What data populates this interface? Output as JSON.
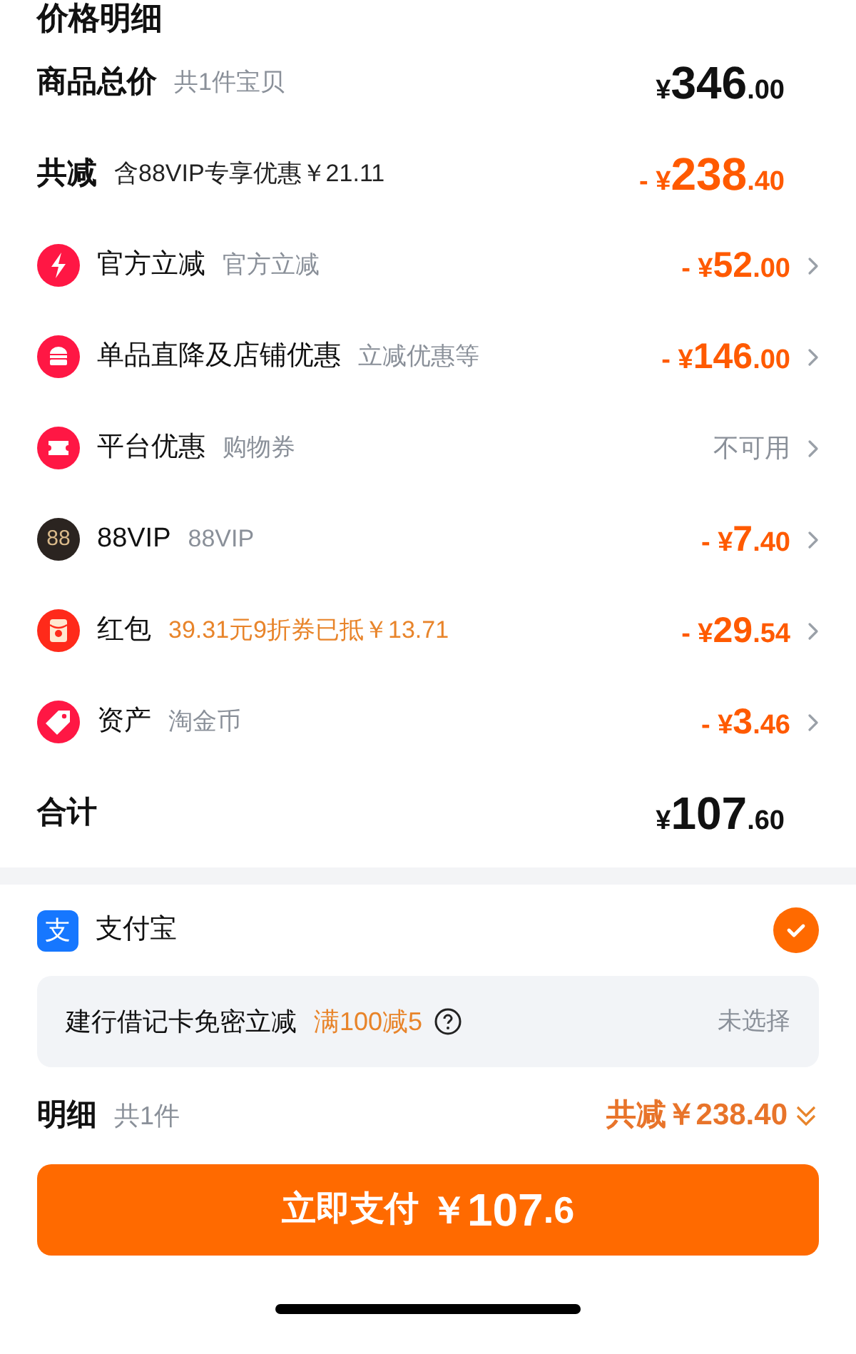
{
  "title": "价格明细",
  "summary": [
    {
      "kind": "total",
      "label": "商品总价",
      "note": "共1件宝贝",
      "prefix": "¥",
      "whole": "346",
      "fraction": ".00"
    },
    {
      "kind": "discount",
      "label": "共减",
      "note": "含88VIP专享优惠￥21.11",
      "prefix": "- ¥",
      "whole": "238",
      "fraction": ".40"
    }
  ],
  "items": [
    {
      "label": "官方立减",
      "note": "官方立减",
      "note_highlight": false,
      "kind": "amount",
      "prefix": "- ¥",
      "whole": "52",
      "fraction": ".00"
    },
    {
      "label": "单品直降及店铺优惠",
      "note": "立减优惠等",
      "note_highlight": false,
      "kind": "amount",
      "prefix": "- ¥",
      "whole": "146",
      "fraction": ".00"
    },
    {
      "label": "平台优惠",
      "note": "购物券",
      "note_highlight": false,
      "kind": "status",
      "status": "不可用"
    },
    {
      "icon_text": "88",
      "label": "88VIP",
      "note": "88VIP",
      "note_highlight": false,
      "kind": "amount",
      "prefix": "- ¥",
      "whole": "7",
      "fraction": ".40"
    },
    {
      "label": "红包",
      "note": "39.31元9折券已抵￥13.71",
      "note_highlight": true,
      "kind": "amount",
      "prefix": "- ¥",
      "whole": "29",
      "fraction": ".54"
    },
    {
      "label": "资产",
      "note": "淘金币",
      "note_highlight": false,
      "kind": "amount",
      "prefix": "- ¥",
      "whole": "3",
      "fraction": ".46"
    }
  ],
  "total": {
    "label": "合计",
    "prefix": "¥",
    "whole": "107",
    "fraction": ".60"
  },
  "payment": {
    "icon_text": "支",
    "name": "支付宝",
    "selected": true
  },
  "promo": {
    "label": "建行借记卡免密立减",
    "offer": "满100减5",
    "status": "未选择"
  },
  "detail": {
    "label": "明细",
    "count": "共1件",
    "discount": "共减￥238.40"
  },
  "pay_button": {
    "label": "立即支付",
    "prefix": "￥",
    "whole": "107",
    "fraction": ".6"
  }
}
